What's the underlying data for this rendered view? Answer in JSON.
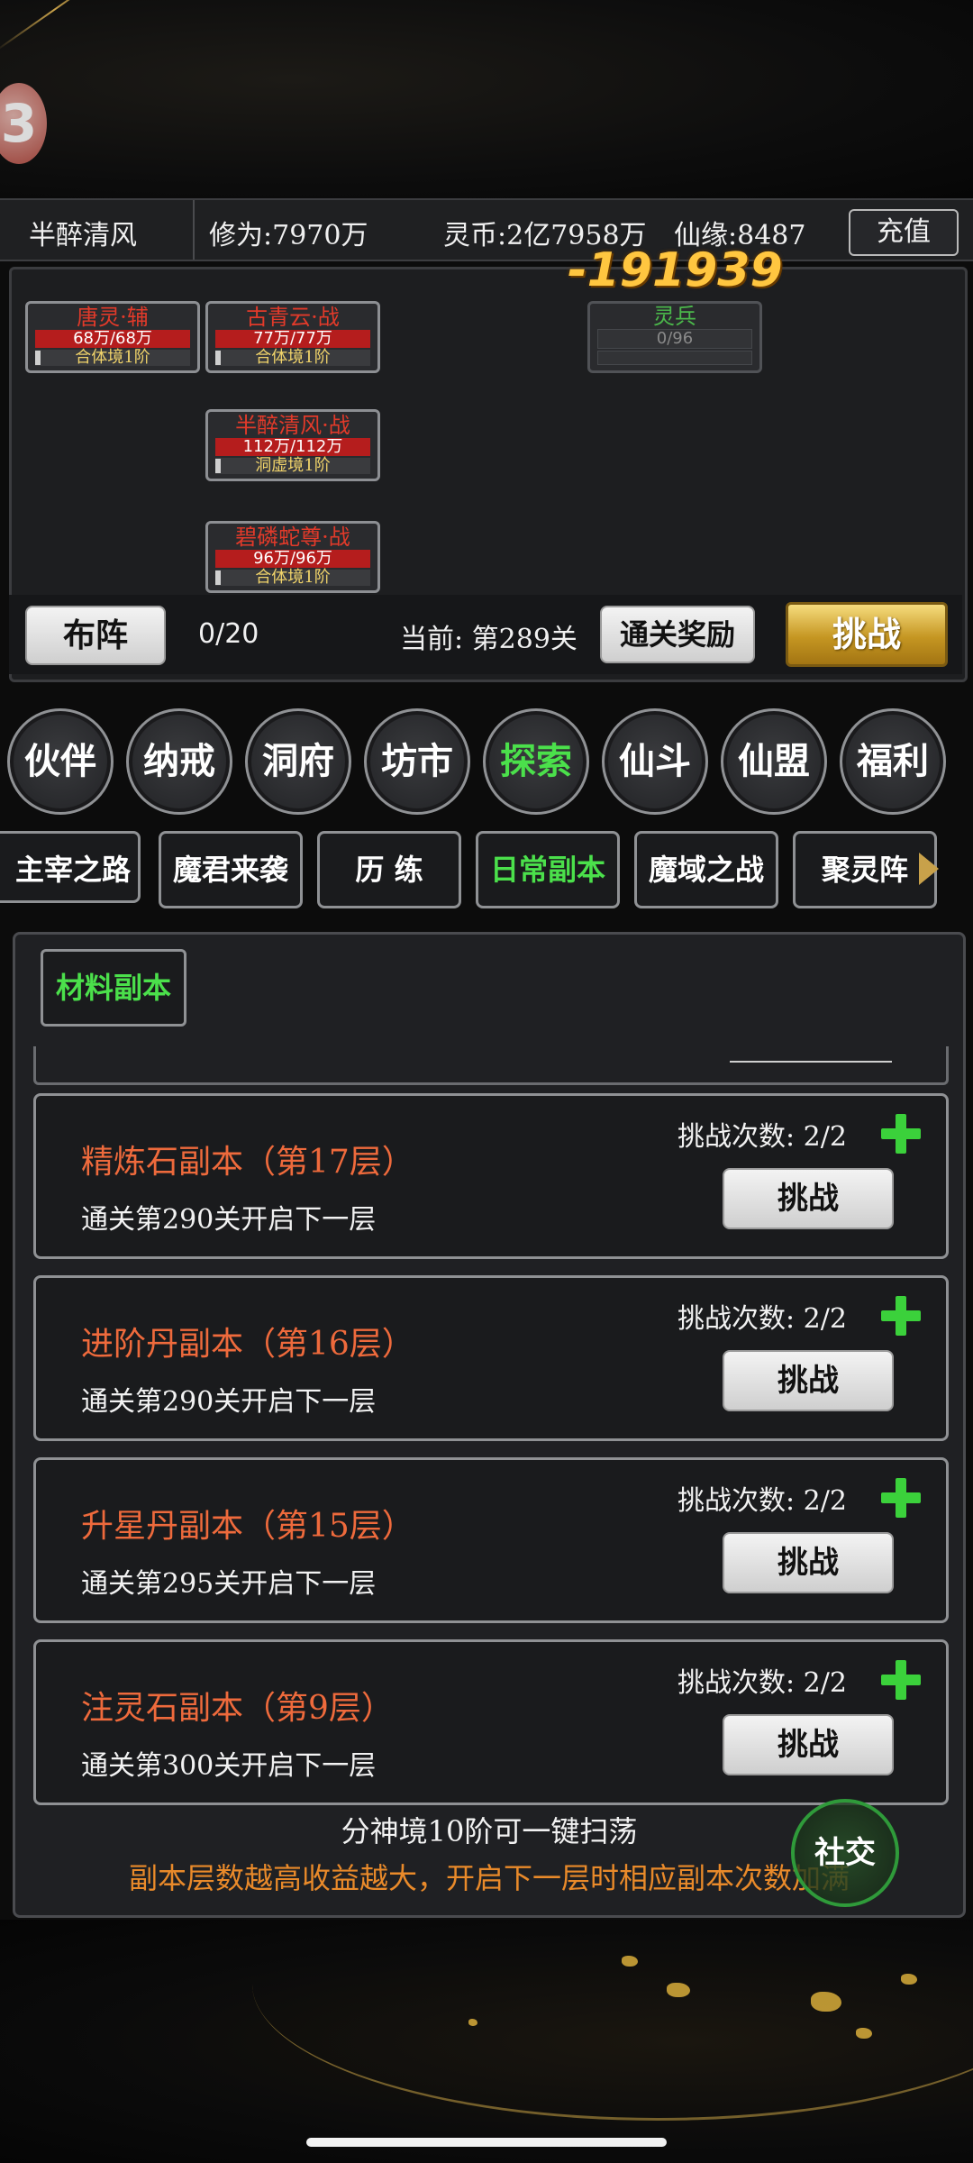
{
  "header": {
    "player_name": "半醉清风",
    "cultivation": "修为:7970万",
    "spirit_coins": "灵币:2亿7958万",
    "fate": "仙缘:8487",
    "recharge_label": "充值"
  },
  "battle": {
    "damage_popup": "-191939",
    "units": [
      {
        "name": "唐灵·辅",
        "hp": "68万/68万",
        "realm": "合体境1阶"
      },
      {
        "name": "古青云·战",
        "hp": "77万/77万",
        "realm": "合体境1阶"
      },
      {
        "name": "半醉清风·战",
        "hp": "112万/112万",
        "realm": "洞虚境1阶"
      },
      {
        "name": "碧磷蛇尊·战",
        "hp": "96万/96万",
        "realm": "合体境1阶"
      }
    ],
    "spirit_soldier": {
      "name": "灵兵",
      "value": "0/96"
    },
    "formation_label": "布阵",
    "formation_count": "0/20",
    "current_stage": "当前: 第289关",
    "clear_reward_label": "通关奖励",
    "challenge_label": "挑战"
  },
  "circle_nav": [
    {
      "label": "伙伴",
      "active": false
    },
    {
      "label": "纳戒",
      "active": false
    },
    {
      "label": "洞府",
      "active": false
    },
    {
      "label": "坊市",
      "active": false
    },
    {
      "label": "探索",
      "active": true
    },
    {
      "label": "仙斗",
      "active": false
    },
    {
      "label": "仙盟",
      "active": false
    },
    {
      "label": "福利",
      "active": false
    }
  ],
  "tab_nav": [
    {
      "label": "主宰之路",
      "active": false
    },
    {
      "label": "魔君来袭",
      "active": false
    },
    {
      "label": "历 练",
      "active": false
    },
    {
      "label": "日常副本",
      "active": true
    },
    {
      "label": "魔域之战",
      "active": false
    },
    {
      "label": "聚灵阵",
      "active": false
    }
  ],
  "dungeon_panel": {
    "subtab_label": "材料副本",
    "cards": [
      {
        "title": "精炼石副本（第17层）",
        "desc": "通关第290关开启下一层",
        "count": "挑战次数: 2/2",
        "button": "挑战"
      },
      {
        "title": "进阶丹副本（第16层）",
        "desc": "通关第290关开启下一层",
        "count": "挑战次数: 2/2",
        "button": "挑战"
      },
      {
        "title": "升星丹副本（第15层）",
        "desc": "通关第295关开启下一层",
        "count": "挑战次数: 2/2",
        "button": "挑战"
      },
      {
        "title": "注灵石副本（第9层）",
        "desc": "通关第300关开启下一层",
        "count": "挑战次数: 2/2",
        "button": "挑战"
      }
    ],
    "sweep_note": "分神境10阶可一键扫荡",
    "reward_note": "副本层数越高收益越大，开启下一层时相应副本次数加满"
  },
  "social_label": "社交",
  "colors": {
    "active_green": "#4be04b",
    "title_orange": "#ee6a3c",
    "note_orange": "#e98a2a",
    "gold": "#c59622"
  }
}
